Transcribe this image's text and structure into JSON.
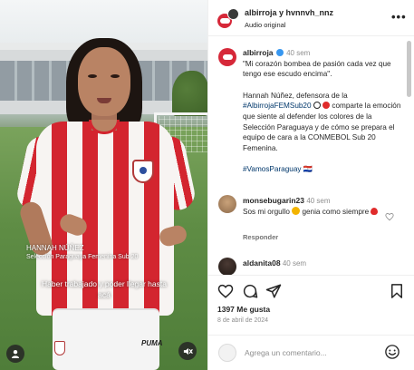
{
  "video": {
    "player_name": "HANNAH NÚÑEZ",
    "player_subtitle": "Selección Paraguaya Femenina Sub 20",
    "caption": "Haber trabajado y poder llegar hasta acá",
    "kit_brand": "PUMA"
  },
  "header": {
    "authors": "albirroja y hvnnvh_nnz",
    "audio": "Audio original",
    "more": "•••"
  },
  "post": {
    "username": "albirroja",
    "time": "40 sem",
    "quote": "\"Mi corazón bombea de pasión cada vez que tengo ese escudo encima\".",
    "body_before_tag": "Hannah Núñez, defensora de la ",
    "tag": "#AlbirrojaFEMSub20",
    "body_after_tag": " comparte la emoción que siente al defender los colores de la Selección Paraguaya y de cómo se prepara el equipo de cara a la CONMEBOL Sub 20 Femenina.",
    "hashtags": "#VamosParaguay 🇵🇾"
  },
  "comments": [
    {
      "username": "monsebugarin23",
      "time": "40 sem",
      "text_before": "Sos mi orgullo",
      "text_after": " genia como siempre",
      "reply_label": "Responder"
    },
    {
      "username": "aldanita08",
      "time": "40 sem",
      "text_before": "",
      "text_after": ""
    }
  ],
  "stats": {
    "likes": "1397 Me gusta",
    "date": "8 de abril de 2024"
  },
  "comment_box": {
    "placeholder": "Agrega un comentario..."
  },
  "colors": {
    "brand_red": "#d62839",
    "link_blue": "#00376b",
    "verified_blue": "#3897f0",
    "heart_red": "#ed4956"
  }
}
